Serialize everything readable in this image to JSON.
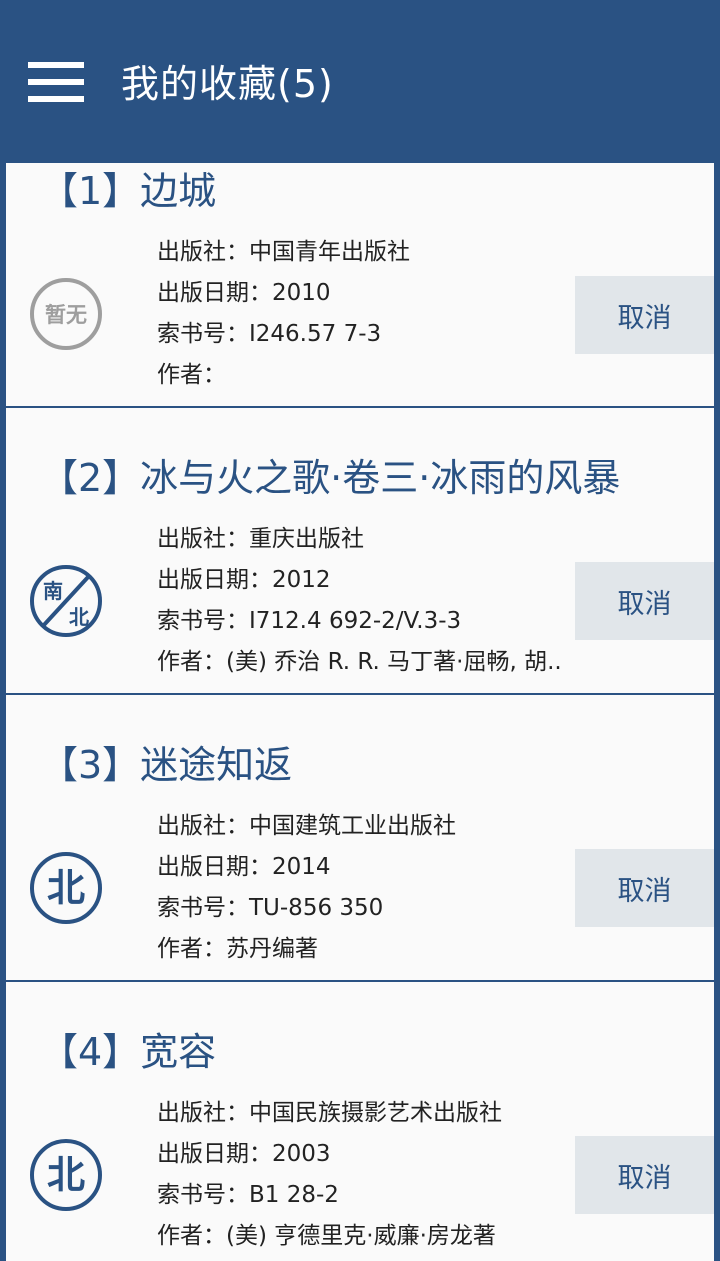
{
  "header": {
    "title": "我的收藏(5)",
    "menu_icon": "hamburger-menu-icon",
    "background_color": "#2a5283"
  },
  "labels": {
    "publisher": "出版社：",
    "date": "出版日期：",
    "call_number": "索书号：",
    "author": "作者："
  },
  "books": [
    {
      "title": "【1】边城",
      "badge_icon": "no-image-badge-icon",
      "badge_text": "暂无",
      "publisher": "中国青年出版社",
      "date": "2010",
      "call_number": "I246.57 7-3",
      "author": "",
      "cancel_label": "取消"
    },
    {
      "title": "【2】冰与火之歌·卷三·冰雨的风暴",
      "badge_icon": "nanbei-library-badge-icon",
      "publisher": "重庆出版社",
      "date": "2012",
      "call_number": "I712.4 692-2/V.3-3",
      "author": "(美) 乔治 R. R. 马丁著·屈畅, 胡..",
      "cancel_label": "取消"
    },
    {
      "title": "【3】迷途知返",
      "badge_icon": "bei-library-badge-icon",
      "publisher": "中国建筑工业出版社",
      "date": "2014",
      "call_number": "TU-856 350",
      "author": "苏丹编著",
      "cancel_label": "取消"
    },
    {
      "title": "【4】宽容",
      "badge_icon": "bei-library-badge-icon",
      "publisher": "中国民族摄影艺术出版社",
      "date": "2003",
      "call_number": "B1 28-2",
      "author": "(美) 亨德里克·威廉·房龙著",
      "cancel_label": "取消"
    }
  ]
}
